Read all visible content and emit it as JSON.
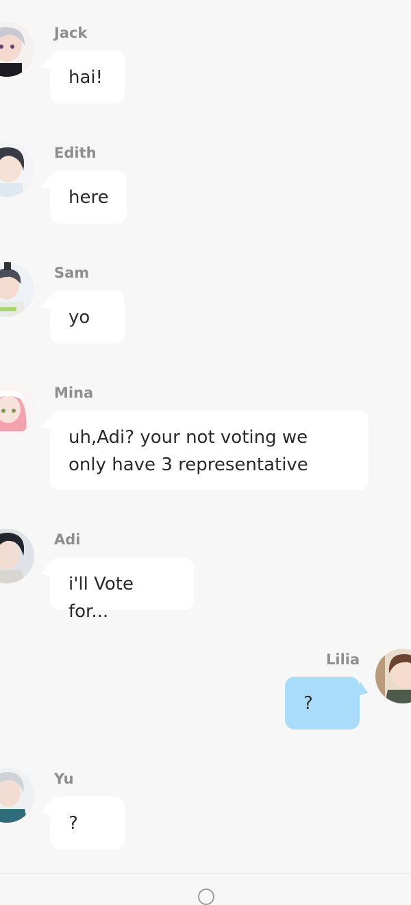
{
  "messages": [
    {
      "sender": "Jack",
      "text": "hai!",
      "side": "left",
      "hair_color": "#c9c9d4"
    },
    {
      "sender": "Edith",
      "text": "here",
      "side": "left",
      "hair_color": "#3b3b45"
    },
    {
      "sender": "Sam",
      "text": "yo",
      "side": "left",
      "hair_color": "#4b4f5a"
    },
    {
      "sender": "Mina",
      "text": "uh,Adi? your not voting we only have 3 representative",
      "side": "left",
      "hair_color": "#f2a3ad"
    },
    {
      "sender": "Adi",
      "text": "i'll Vote for...",
      "side": "left",
      "hair_color": "#22252d"
    },
    {
      "sender": "Lilia",
      "text": "?",
      "side": "right",
      "hair_color": "#6b4432"
    },
    {
      "sender": "Yu",
      "text": "?",
      "side": "left",
      "hair_color": "#cfd3d8"
    }
  ],
  "colors": {
    "background": "#f7f7f7",
    "incoming_bubble": "#ffffff",
    "outgoing_bubble": "#a9dcfb",
    "name_text": "#8e8e8e"
  }
}
